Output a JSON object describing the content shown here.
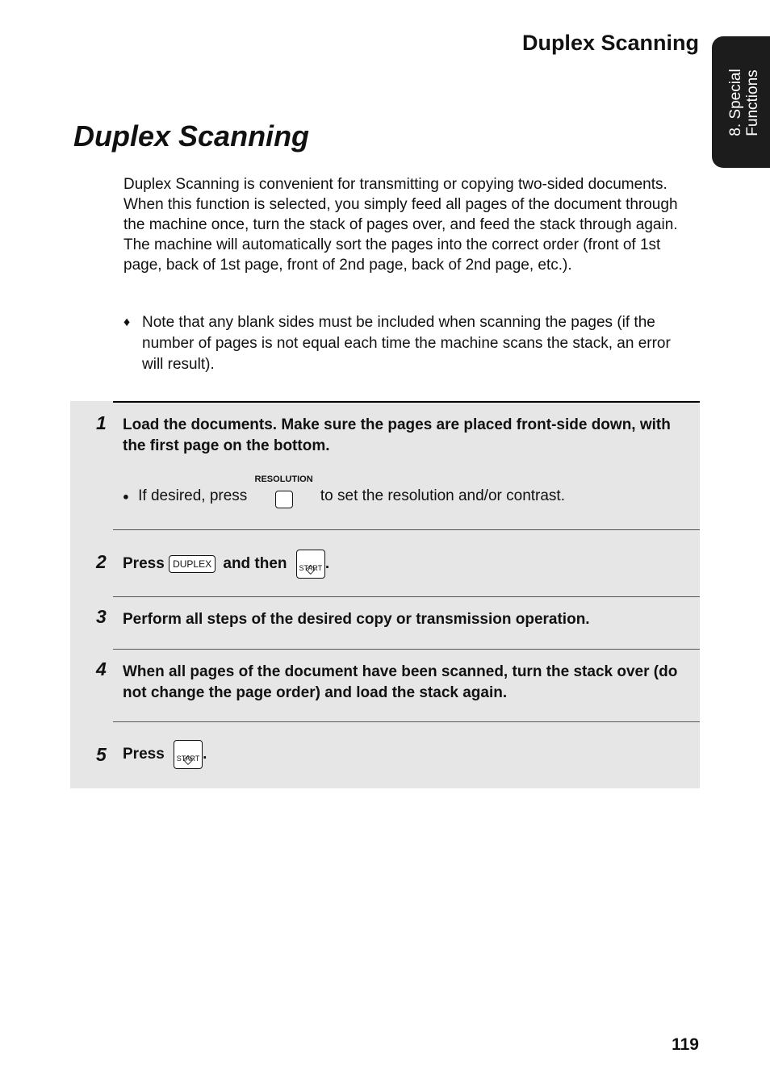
{
  "header": {
    "running_title": "Duplex Scanning"
  },
  "side_tab": {
    "line1": "8. Special",
    "line2": "Functions"
  },
  "title": "Duplex Scanning",
  "intro": "Duplex Scanning is convenient for transmitting or copying two-sided documents. When this function is selected, you simply feed all pages of the document through the machine once, turn the stack of pages over, and feed the stack through again. The machine will automatically sort the pages into the correct order (front of 1st page, back of 1st page, front of 2nd page, back of 2nd page, etc.).",
  "note": {
    "bullet": "♦",
    "text": "Note that any blank sides must be included when scanning the pages (if the number of pages is not equal each time the machine scans the stack, an error will result)."
  },
  "steps": [
    {
      "num": "1",
      "text": "Load the documents. Make sure the pages are placed front-side down, with the first page on the bottom.",
      "sub": {
        "bullet": "●",
        "before": "If desired, press",
        "key_label": "RESOLUTION",
        "after": "to set the resolution and/or contrast."
      }
    },
    {
      "num": "2",
      "press": "Press",
      "key1": "DUPLEX",
      "and_then": "and then",
      "key2_label": "START",
      "key2_glyph": "◇",
      "end": "."
    },
    {
      "num": "3",
      "text": "Perform all steps of the desired copy or transmission operation."
    },
    {
      "num": "4",
      "text": "When all pages of the document have been scanned, turn the stack over (do not change the page order) and load the stack again."
    },
    {
      "num": "5",
      "press": "Press",
      "key_label": "START",
      "key_glyph": "◇",
      "end": "."
    }
  ],
  "page_number": "119"
}
